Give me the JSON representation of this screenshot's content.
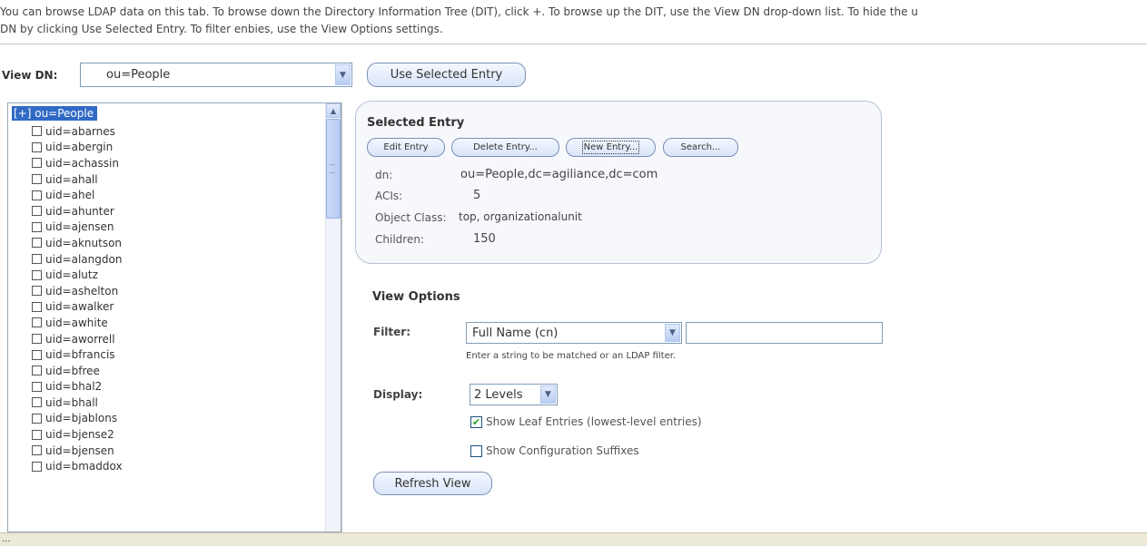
{
  "intro": {
    "line1": "You can browse LDAP data on this tab. To browse down the Directory Information Tree (DIT), click +. To browse up the DIT, use the View DN drop-down list. To hide the u",
    "line2": "DN by clicking Use Selected Entry. To filter enbies, use the View Options settings."
  },
  "view_dn": {
    "label": "View DN:",
    "value": "ou=People",
    "use_selected_label": "Use Selected Entry"
  },
  "tree": {
    "root_label": "[+] ou=People",
    "items": [
      "uid=abarnes",
      "uid=abergin",
      "uid=achassin",
      "uid=ahall",
      "uid=ahel",
      "uid=ahunter",
      "uid=ajensen",
      "uid=aknutson",
      "uid=alangdon",
      "uid=alutz",
      "uid=ashelton",
      "uid=awalker",
      "uid=awhite",
      "uid=aworrell",
      "uid=bfrancis",
      "uid=bfree",
      "uid=bhal2",
      "uid=bhall",
      "uid=bjablons",
      "uid=bjense2",
      "uid=bjensen",
      "uid=bmaddox"
    ]
  },
  "selected_entry": {
    "title": "Selected Entry",
    "buttons": {
      "edit": "Edit Entry",
      "delete": "Delete Entry...",
      "new": "New Entry...",
      "search": "Search..."
    },
    "fields": [
      {
        "key": "dn:",
        "value": "ou=People,dc=agiliance,dc=com"
      },
      {
        "key": "ACIs:",
        "value": "5"
      },
      {
        "key": "Object Class:",
        "value": "top, organizationalunit"
      },
      {
        "key": "Children:",
        "value": "150"
      }
    ]
  },
  "view_options": {
    "title": "View Options",
    "filter_label": "Filter:",
    "filter_type": "Full Name (cn)",
    "filter_value": "",
    "filter_hint": "Enter a string to be matched or an LDAP filter.",
    "display_label": "Display:",
    "display_value": "2 Levels",
    "show_leaf_label": "Show Leaf Entries (lowest-level entries)",
    "show_leaf_checked": true,
    "show_config_label": "Show Configuration Suffixes",
    "show_config_checked": false,
    "refresh_label": "Refresh View"
  },
  "status": {
    "text": "..."
  },
  "icons": {
    "dropdown": "chevron-down-icon",
    "scroll_up": "scroll-up-arrow-icon",
    "check": "check-icon"
  }
}
